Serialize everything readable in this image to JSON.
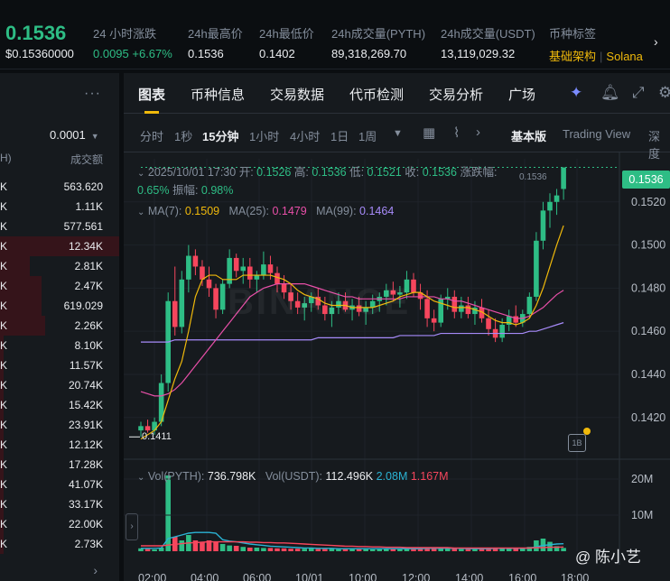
{
  "ticker": {
    "last_price": "0.1536",
    "sub_price": "$0.15360000",
    "change_label": "24 小时涨跌",
    "change_value": "0.0095 +6.67%",
    "high_label": "24h最高价",
    "high_value": "0.1536",
    "low_label": "24h最低价",
    "low_value": "0.1402",
    "vol_base_label": "24h成交量(PYTH)",
    "vol_base_value": "89,318,269.70",
    "vol_quote_label": "24h成交量(USDT)",
    "vol_quote_value": "13,119,029.32",
    "tags_label": "币种标签",
    "tag_primary": "基础架构",
    "tag_secondary": "Solana"
  },
  "book": {
    "precision": "0.0001",
    "col_left": "H)",
    "col_right": "成交额",
    "rows": [
      {
        "k": "K",
        "vol": "563.620",
        "depth": 0
      },
      {
        "k": "K",
        "vol": "1.11K",
        "depth": 0
      },
      {
        "k": "K",
        "vol": "577.561",
        "depth": 0
      },
      {
        "k": "K",
        "vol": "12.34K",
        "depth": 1.0
      },
      {
        "k": "K",
        "vol": "2.81K",
        "depth": 0.25
      },
      {
        "k": "K",
        "vol": "2.47K",
        "depth": 0.35
      },
      {
        "k": "K",
        "vol": "619.029",
        "depth": 0.35
      },
      {
        "k": "K",
        "vol": "2.26K",
        "depth": 0.38
      },
      {
        "k": "K",
        "vol": "8.10K",
        "depth": 0.03
      },
      {
        "k": "K",
        "vol": "11.57K",
        "depth": 0.03
      },
      {
        "k": "K",
        "vol": "20.74K",
        "depth": 0.03
      },
      {
        "k": "K",
        "vol": "15.42K",
        "depth": 0.03
      },
      {
        "k": "K",
        "vol": "23.91K",
        "depth": 0.03
      },
      {
        "k": "K",
        "vol": "12.12K",
        "depth": 0.03
      },
      {
        "k": "K",
        "vol": "17.28K",
        "depth": 0.03
      },
      {
        "k": "K",
        "vol": "41.07K",
        "depth": 0.03
      },
      {
        "k": "K",
        "vol": "33.17K",
        "depth": 0.03
      },
      {
        "k": "K",
        "vol": "22.00K",
        "depth": 0.03
      },
      {
        "k": "K",
        "vol": "2.73K",
        "depth": 0.03
      }
    ]
  },
  "tabs": [
    "图表",
    "币种信息",
    "交易数据",
    "代币检测",
    "交易分析",
    "广场"
  ],
  "intervals": [
    "分时",
    "1秒",
    "15分钟",
    "1小时",
    "4小时",
    "1日",
    "1周"
  ],
  "view_modes": {
    "basic": "基本版",
    "tradingview": "Trading View",
    "depth": "深度"
  },
  "ohlc": {
    "date": "2025/10/01 17:30",
    "open_label": "开:",
    "open": "0.1526",
    "high_label": "高:",
    "high": "0.1536",
    "low_label": "低:",
    "low": "0.1521",
    "close_label": "收:",
    "close": "0.1536",
    "chg_label": "涨跌幅:",
    "chg": "0.65%",
    "amp_label": "振幅:",
    "amp": "0.98%"
  },
  "ma": {
    "ma7_label": "MA(7):",
    "ma7": "0.1509",
    "ma25_label": "MA(25):",
    "ma25": "0.1479",
    "ma99_label": "MA(99):",
    "ma99": "0.1464"
  },
  "volume": {
    "base_label": "Vol(PYTH):",
    "base": "736.798K",
    "quote_label": "Vol(USDT):",
    "quote": "112.496K",
    "ma1": "2.08M",
    "ma2": "1.167M"
  },
  "labels": {
    "current_price_tag": "0.1536",
    "period_low": "0.1411",
    "period_high": "0.1536",
    "watermark": "BINANCE",
    "credit": "@ 陈小艺"
  },
  "colors": {
    "up": "#2ebd85",
    "down": "#f6465d",
    "ma7": "#f0b90b",
    "ma25": "#e84fa8",
    "ma99": "#a78bfa",
    "accent": "#f0b90b"
  },
  "chart_data": {
    "type": "candlestick",
    "y_ticks": [
      "0.1520",
      "0.1500",
      "0.1480",
      "0.1460",
      "0.1440",
      "0.1420"
    ],
    "ylim": [
      0.1404,
      0.154
    ],
    "x_ticks": [
      "02:00",
      "04:00",
      "06:00",
      "10/01",
      "10:00",
      "12:00",
      "14:00",
      "16:00",
      "18:00"
    ],
    "vol_ticks": [
      "20M",
      "10M"
    ],
    "candles": [
      [
        0.1414,
        0.1418,
        0.1411,
        0.1416
      ],
      [
        0.1416,
        0.1419,
        0.1413,
        0.1414
      ],
      [
        0.1414,
        0.142,
        0.1412,
        0.1418
      ],
      [
        0.1418,
        0.144,
        0.1416,
        0.1436
      ],
      [
        0.1436,
        0.1478,
        0.1432,
        0.1474
      ],
      [
        0.1474,
        0.149,
        0.1458,
        0.1462
      ],
      [
        0.1462,
        0.1488,
        0.1459,
        0.1484
      ],
      [
        0.1484,
        0.15,
        0.1478,
        0.1495
      ],
      [
        0.1495,
        0.1498,
        0.1486,
        0.149
      ],
      [
        0.149,
        0.1493,
        0.1481,
        0.1484
      ],
      [
        0.1484,
        0.149,
        0.1476,
        0.148
      ],
      [
        0.148,
        0.1482,
        0.1466,
        0.147
      ],
      [
        0.147,
        0.1484,
        0.1468,
        0.1482
      ],
      [
        0.1482,
        0.1498,
        0.148,
        0.1494
      ],
      [
        0.1494,
        0.1496,
        0.1485,
        0.1488
      ],
      [
        0.1488,
        0.1494,
        0.1482,
        0.149
      ],
      [
        0.149,
        0.1494,
        0.148,
        0.1484
      ],
      [
        0.1484,
        0.1488,
        0.1478,
        0.1486
      ],
      [
        0.1486,
        0.1497,
        0.1484,
        0.1491
      ],
      [
        0.1491,
        0.1495,
        0.1484,
        0.1487
      ],
      [
        0.1487,
        0.149,
        0.1478,
        0.1482
      ],
      [
        0.1482,
        0.1486,
        0.1475,
        0.1478
      ],
      [
        0.1478,
        0.1482,
        0.147,
        0.1474
      ],
      [
        0.1474,
        0.1478,
        0.1468,
        0.1471
      ],
      [
        0.1471,
        0.1476,
        0.1465,
        0.1473
      ],
      [
        0.1473,
        0.1478,
        0.1469,
        0.1476
      ],
      [
        0.1476,
        0.148,
        0.147,
        0.1472
      ],
      [
        0.1472,
        0.1476,
        0.1465,
        0.1468
      ],
      [
        0.1468,
        0.1474,
        0.1462,
        0.1471
      ],
      [
        0.1471,
        0.1478,
        0.1468,
        0.1474
      ],
      [
        0.1474,
        0.1478,
        0.1469,
        0.147
      ],
      [
        0.147,
        0.1475,
        0.1465,
        0.1472
      ],
      [
        0.1472,
        0.1476,
        0.1467,
        0.1469
      ],
      [
        0.1469,
        0.1474,
        0.1463,
        0.1471
      ],
      [
        0.1471,
        0.1477,
        0.1468,
        0.1474
      ],
      [
        0.1474,
        0.1478,
        0.1469,
        0.1476
      ],
      [
        0.1476,
        0.1482,
        0.1472,
        0.1479
      ],
      [
        0.1479,
        0.1483,
        0.1474,
        0.1477
      ],
      [
        0.1477,
        0.1481,
        0.1471,
        0.1478
      ],
      [
        0.1478,
        0.1488,
        0.1475,
        0.1484
      ],
      [
        0.1484,
        0.1487,
        0.1476,
        0.1478
      ],
      [
        0.1478,
        0.1482,
        0.147,
        0.1475
      ],
      [
        0.1475,
        0.1479,
        0.1462,
        0.1466
      ],
      [
        0.1466,
        0.147,
        0.146,
        0.1464
      ],
      [
        0.1464,
        0.1477,
        0.1462,
        0.1475
      ],
      [
        0.1475,
        0.148,
        0.147,
        0.1476
      ],
      [
        0.1476,
        0.1479,
        0.1466,
        0.1469
      ],
      [
        0.1469,
        0.1476,
        0.1466,
        0.1472
      ],
      [
        0.1472,
        0.1476,
        0.1466,
        0.1468
      ],
      [
        0.1468,
        0.1474,
        0.1463,
        0.1471
      ],
      [
        0.1471,
        0.1475,
        0.1464,
        0.1466
      ],
      [
        0.1466,
        0.147,
        0.1458,
        0.1461
      ],
      [
        0.1461,
        0.1466,
        0.1455,
        0.1457
      ],
      [
        0.1457,
        0.1466,
        0.1455,
        0.1463
      ],
      [
        0.1463,
        0.147,
        0.146,
        0.1467
      ],
      [
        0.1467,
        0.1472,
        0.1462,
        0.1464
      ],
      [
        0.1464,
        0.147,
        0.1462,
        0.1468
      ],
      [
        0.1468,
        0.1478,
        0.1466,
        0.1476
      ],
      [
        0.1476,
        0.1506,
        0.1474,
        0.1502
      ],
      [
        0.1502,
        0.152,
        0.1498,
        0.1516
      ],
      [
        0.1516,
        0.1524,
        0.1508,
        0.152
      ],
      [
        0.152,
        0.1526,
        0.1514,
        0.1523
      ],
      [
        0.1526,
        0.1536,
        0.1521,
        0.1536
      ]
    ],
    "ma7": [
      0.141,
      0.1412,
      0.1414,
      0.1418,
      0.1428,
      0.1438,
      0.1446,
      0.146,
      0.1476,
      0.1484,
      0.1486,
      0.1486,
      0.1484,
      0.1484,
      0.1484,
      0.1486,
      0.1486,
      0.1486,
      0.1486,
      0.1486,
      0.1485,
      0.1484,
      0.1482,
      0.1479,
      0.1477,
      0.1476,
      0.1475,
      0.1473,
      0.1472,
      0.1472,
      0.1472,
      0.1471,
      0.1471,
      0.1471,
      0.1471,
      0.1472,
      0.1473,
      0.1474,
      0.1476,
      0.1477,
      0.1478,
      0.1478,
      0.1476,
      0.1474,
      0.1473,
      0.1472,
      0.1471,
      0.1471,
      0.1471,
      0.147,
      0.1469,
      0.1467,
      0.1465,
      0.1464,
      0.1464,
      0.1463,
      0.1464,
      0.1466,
      0.1472,
      0.148,
      0.149,
      0.15,
      0.1509
    ],
    "ma25": [
      0.1432,
      0.1431,
      0.143,
      0.143,
      0.1431,
      0.1433,
      0.1436,
      0.144,
      0.1444,
      0.1448,
      0.1452,
      0.1456,
      0.146,
      0.1464,
      0.1468,
      0.1472,
      0.1476,
      0.1478,
      0.148,
      0.1481,
      0.1482,
      0.1482,
      0.1482,
      0.1482,
      0.1482,
      0.1481,
      0.148,
      0.1479,
      0.1478,
      0.1477,
      0.1476,
      0.1476,
      0.1475,
      0.1475,
      0.1475,
      0.1475,
      0.1475,
      0.1475,
      0.1475,
      0.1476,
      0.1476,
      0.1476,
      0.1476,
      0.1476,
      0.1475,
      0.1475,
      0.1474,
      0.1474,
      0.1473,
      0.1472,
      0.1471,
      0.147,
      0.1469,
      0.1468,
      0.1467,
      0.1466,
      0.1466,
      0.1467,
      0.1469,
      0.1471,
      0.1474,
      0.1477,
      0.1479
    ],
    "ma99": [
      0.1455,
      0.1455,
      0.1455,
      0.1455,
      0.1455,
      0.1456,
      0.1456,
      0.1456,
      0.1456,
      0.1456,
      0.1456,
      0.1456,
      0.1456,
      0.1456,
      0.1456,
      0.1456,
      0.1456,
      0.1456,
      0.1456,
      0.1456,
      0.1456,
      0.1456,
      0.1456,
      0.1456,
      0.1456,
      0.1456,
      0.1457,
      0.1457,
      0.1457,
      0.1457,
      0.1457,
      0.1457,
      0.1457,
      0.1457,
      0.1457,
      0.1457,
      0.1457,
      0.1457,
      0.1458,
      0.1458,
      0.1458,
      0.1458,
      0.1458,
      0.1458,
      0.1459,
      0.1459,
      0.1459,
      0.1459,
      0.1459,
      0.1459,
      0.1459,
      0.1459,
      0.1459,
      0.1459,
      0.1459,
      0.1459,
      0.1459,
      0.146,
      0.146,
      0.1461,
      0.1462,
      0.1463,
      0.1464
    ],
    "volume_m": [
      0.8,
      0.6,
      0.5,
      1.0,
      21.0,
      4.0,
      3.0,
      4.5,
      3.0,
      2.6,
      3.0,
      2.5,
      2.0,
      1.6,
      1.5,
      1.2,
      1.0,
      1.0,
      0.9,
      0.9,
      0.8,
      0.8,
      0.7,
      0.7,
      0.7,
      0.8,
      0.6,
      0.6,
      0.7,
      0.6,
      0.6,
      0.7,
      0.6,
      0.6,
      0.5,
      0.6,
      0.7,
      0.6,
      0.6,
      0.8,
      0.7,
      0.7,
      0.9,
      0.9,
      0.8,
      0.7,
      0.7,
      0.6,
      0.6,
      0.6,
      0.7,
      0.9,
      1.0,
      0.9,
      0.8,
      0.7,
      0.8,
      1.2,
      3.0,
      3.5,
      2.6,
      1.4,
      0.9
    ],
    "vol_ma1_m": [
      0.8,
      0.8,
      0.8,
      0.9,
      3.5,
      4.0,
      4.5,
      5.0,
      5.2,
      5.2,
      5.2,
      5.0,
      3.2,
      2.8,
      2.6,
      2.3,
      2.0,
      1.8,
      1.6,
      1.4,
      1.3,
      1.2,
      1.1,
      1.0,
      0.9,
      0.9,
      0.8,
      0.8,
      0.8,
      0.7,
      0.7,
      0.7,
      0.7,
      0.7,
      0.7,
      0.7,
      0.7,
      0.7,
      0.7,
      0.7,
      0.7,
      0.7,
      0.8,
      0.8,
      0.8,
      0.8,
      0.8,
      0.8,
      0.7,
      0.7,
      0.7,
      0.7,
      0.8,
      0.8,
      0.8,
      0.8,
      0.8,
      0.9,
      1.2,
      1.6,
      1.8,
      2.0,
      2.08
    ],
    "vol_ma2_m": [
      1.5,
      1.5,
      1.5,
      1.5,
      1.7,
      1.9,
      2.1,
      2.3,
      2.4,
      2.5,
      2.6,
      2.6,
      2.6,
      2.6,
      2.6,
      2.6,
      2.5,
      2.5,
      2.4,
      2.4,
      2.3,
      2.3,
      2.2,
      2.1,
      2.0,
      1.9,
      1.8,
      1.7,
      1.6,
      1.5,
      1.4,
      1.4,
      1.3,
      1.3,
      1.2,
      1.2,
      1.1,
      1.1,
      1.1,
      1.0,
      1.0,
      1.0,
      1.0,
      1.0,
      1.0,
      1.0,
      0.9,
      0.9,
      0.9,
      0.9,
      0.9,
      0.9,
      0.9,
      0.9,
      0.9,
      0.9,
      0.9,
      0.9,
      1.0,
      1.0,
      1.1,
      1.1,
      1.167
    ],
    "vol_max_m": 25
  }
}
